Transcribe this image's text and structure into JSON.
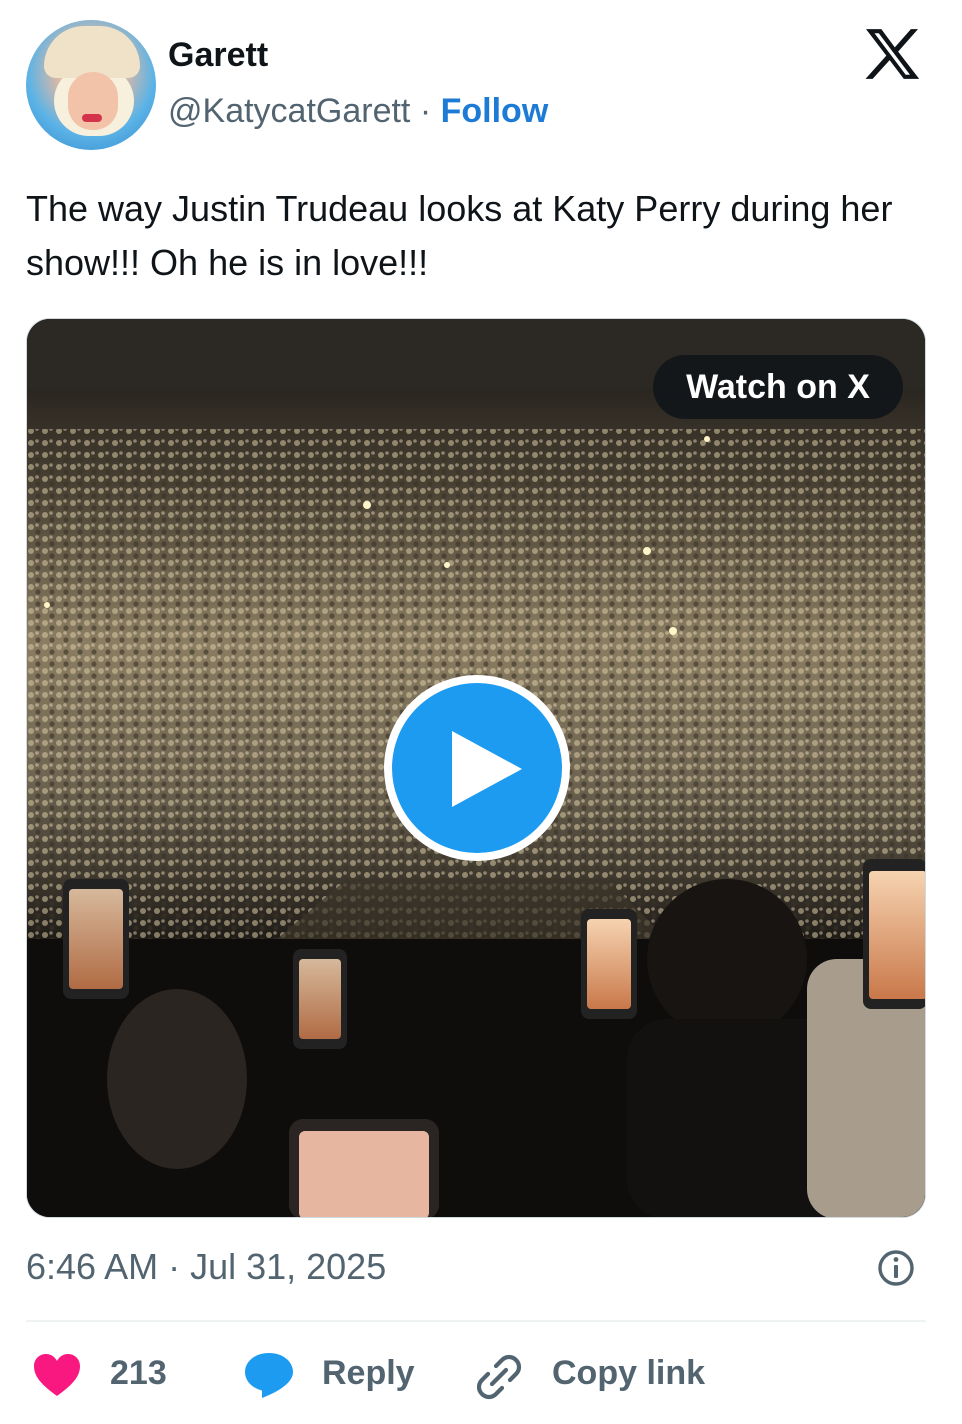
{
  "author": {
    "name": "Garett",
    "handle": "@KatycatGarett",
    "separator": "·",
    "follow_label": "Follow"
  },
  "brand": {
    "logo_icon": "x-logo-icon",
    "follow_color": "#1d7bd6",
    "play_color": "#1d9bf0",
    "heart_color": "#f91880"
  },
  "tweet": {
    "text": "The way Justin Trudeau looks at Katy Perry during her show!!! Oh he is in love!!!"
  },
  "media": {
    "watch_label": "Watch on X",
    "play_icon": "play-icon"
  },
  "meta": {
    "timestamp": "6:46 AM · Jul 31, 2025",
    "info_icon": "info-icon"
  },
  "actions": {
    "like_count": "213",
    "reply_label": "Reply",
    "copy_label": "Copy link"
  }
}
